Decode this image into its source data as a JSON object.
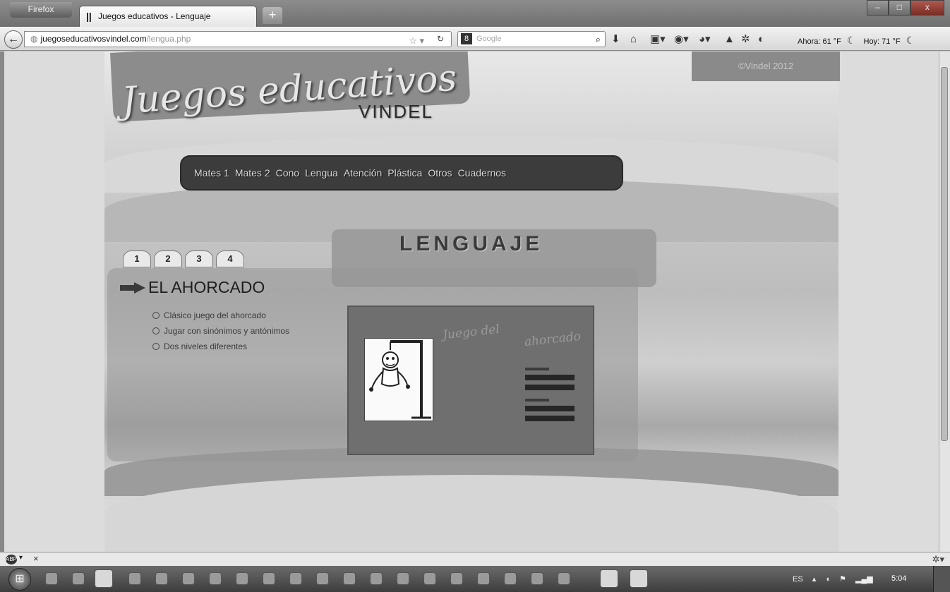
{
  "browser": {
    "firefox_button": "Firefox",
    "tab_title": "Juegos educativos - Lenguaje",
    "new_tab": "+",
    "window_controls": {
      "minimize": "–",
      "maximize": "□",
      "close": "x"
    }
  },
  "navbar": {
    "url_domain": "juegoseducativosvindel.com",
    "url_path": "/lengua.php",
    "search_engine": "8",
    "search_placeholder": "Google",
    "weather_now": "Ahora: 61 °F",
    "weather_today": "Hoy: 71 °F"
  },
  "page": {
    "logo_main": "Juegos educativos",
    "logo_sub": "VINDEL",
    "copyright": "©Vindel 2012",
    "menu": [
      "Mates 1",
      "Mates 2",
      "Cono",
      "Lengua",
      "Atención",
      "Plástica",
      "Otros",
      "Cuadernos"
    ],
    "section_title": "LENGUAJE",
    "page_tabs": [
      "1",
      "2",
      "3",
      "4"
    ],
    "game": {
      "title": "EL AHORCADO",
      "features": [
        "Clásico juego del ahorcado",
        "Jugar con sinónimos y antónimos",
        "Dos niveles diferentes"
      ],
      "thumbnail_title_line1": "Juego del",
      "thumbnail_title_line2": "ahorcado"
    }
  },
  "addon_bar": {
    "close": "×"
  },
  "taskbar": {
    "language": "ES",
    "clock": "5:04"
  },
  "icons": {
    "back": "back-arrow-icon",
    "star": "bookmark-star-icon",
    "reload": "reload-icon",
    "search": "search-icon",
    "download": "download-icon",
    "home": "home-icon"
  }
}
